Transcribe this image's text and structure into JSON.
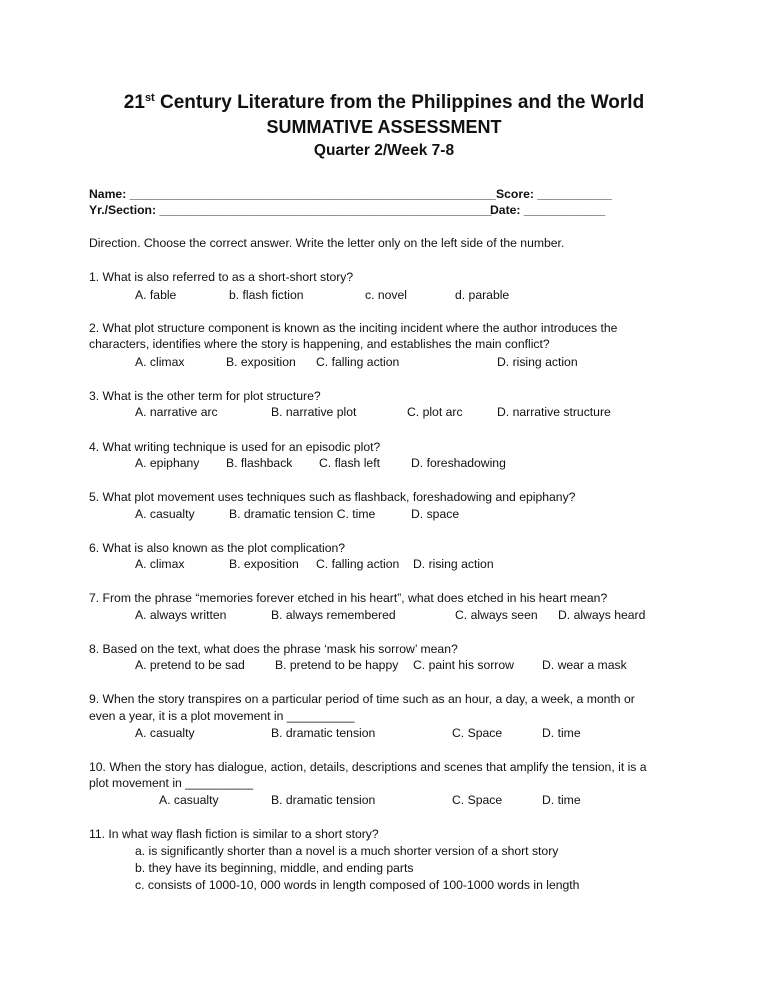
{
  "header": {
    "title_prefix": "21",
    "title_sup": "st",
    "title_rest": " Century Literature from the Philippines and the World",
    "subtitle": "SUMMATIVE ASSESSMENT",
    "quarter": "Quarter 2/Week 7-8"
  },
  "fields": {
    "name": "Name: ______________________________________________________",
    "score": "Score: ___________",
    "section": "Yr./Section: _________________________________________________",
    "date": "Date: ____________"
  },
  "direction": "Direction. Choose the correct answer. Write the letter only on the left side of the number.",
  "questions": [
    {
      "text": [
        "1. What is also referred to as a short-short story?"
      ],
      "choices": [
        "A. fable",
        "b. flash fiction",
        "c. novel",
        "d. parable"
      ]
    },
    {
      "text": [
        "2. What plot structure component is known as the inciting incident where the author introduces the",
        "characters, identifies where the story is happening, and establishes the main conflict?"
      ],
      "choices": [
        "A. climax",
        "B. exposition",
        "C. falling action",
        "D. rising action"
      ]
    },
    {
      "text": [
        "3. What is the other term for plot structure?"
      ],
      "choices": [
        "A. narrative arc",
        "B. narrative plot",
        "C. plot arc",
        "D. narrative structure"
      ]
    },
    {
      "text": [
        "4. What writing technique is used for an episodic plot?"
      ],
      "choices": [
        "A. epiphany",
        "B. flashback",
        "C. flash left",
        "D. foreshadowing"
      ]
    },
    {
      "text": [
        "5. What plot movement uses techniques such as flashback, foreshadowing and epiphany?"
      ],
      "choices": [
        "A. casualty",
        "B. dramatic tension C. time",
        "D. space"
      ]
    },
    {
      "text": [
        "6. What is also known as the plot complication?"
      ],
      "choices": [
        "A. climax",
        "B. exposition",
        "C. falling action",
        "D. rising action"
      ]
    },
    {
      "text": [
        "7. From the phrase “memories forever etched in his heart”, what does etched in his heart mean?"
      ],
      "choices": [
        "A. always written",
        "B. always remembered",
        "C. always seen",
        "D. always heard"
      ]
    },
    {
      "text": [
        "8. Based on the text, what does the phrase ‘mask his sorrow’ mean?"
      ],
      "choices": [
        "A. pretend to be sad",
        "B. pretend to be happy",
        "C. paint his sorrow",
        "D. wear a mask"
      ]
    },
    {
      "text": [
        "9. When the story transpires on a particular period of time such as an hour, a day, a week, a month or",
        "even a year, it is a plot movement in __________"
      ],
      "choices": [
        "A. casualty",
        "B. dramatic tension",
        "C. Space",
        "D. time"
      ]
    },
    {
      "text": [
        "10.  When the story has dialogue, action, details, descriptions and scenes that amplify the tension, it is a",
        "plot movement in __________"
      ],
      "choices": [
        "A. casualty",
        "B. dramatic tension",
        "C. Space",
        "D. time"
      ]
    },
    {
      "text": [
        "11. In what way flash fiction is similar to a short story?"
      ],
      "choices": [
        "a.  is significantly shorter than a novel is a much shorter version of a short story",
        "b. they have its beginning, middle, and ending parts",
        "c. consists of 1000-10, 000 words in length composed of 100-1000 words in length"
      ]
    }
  ]
}
